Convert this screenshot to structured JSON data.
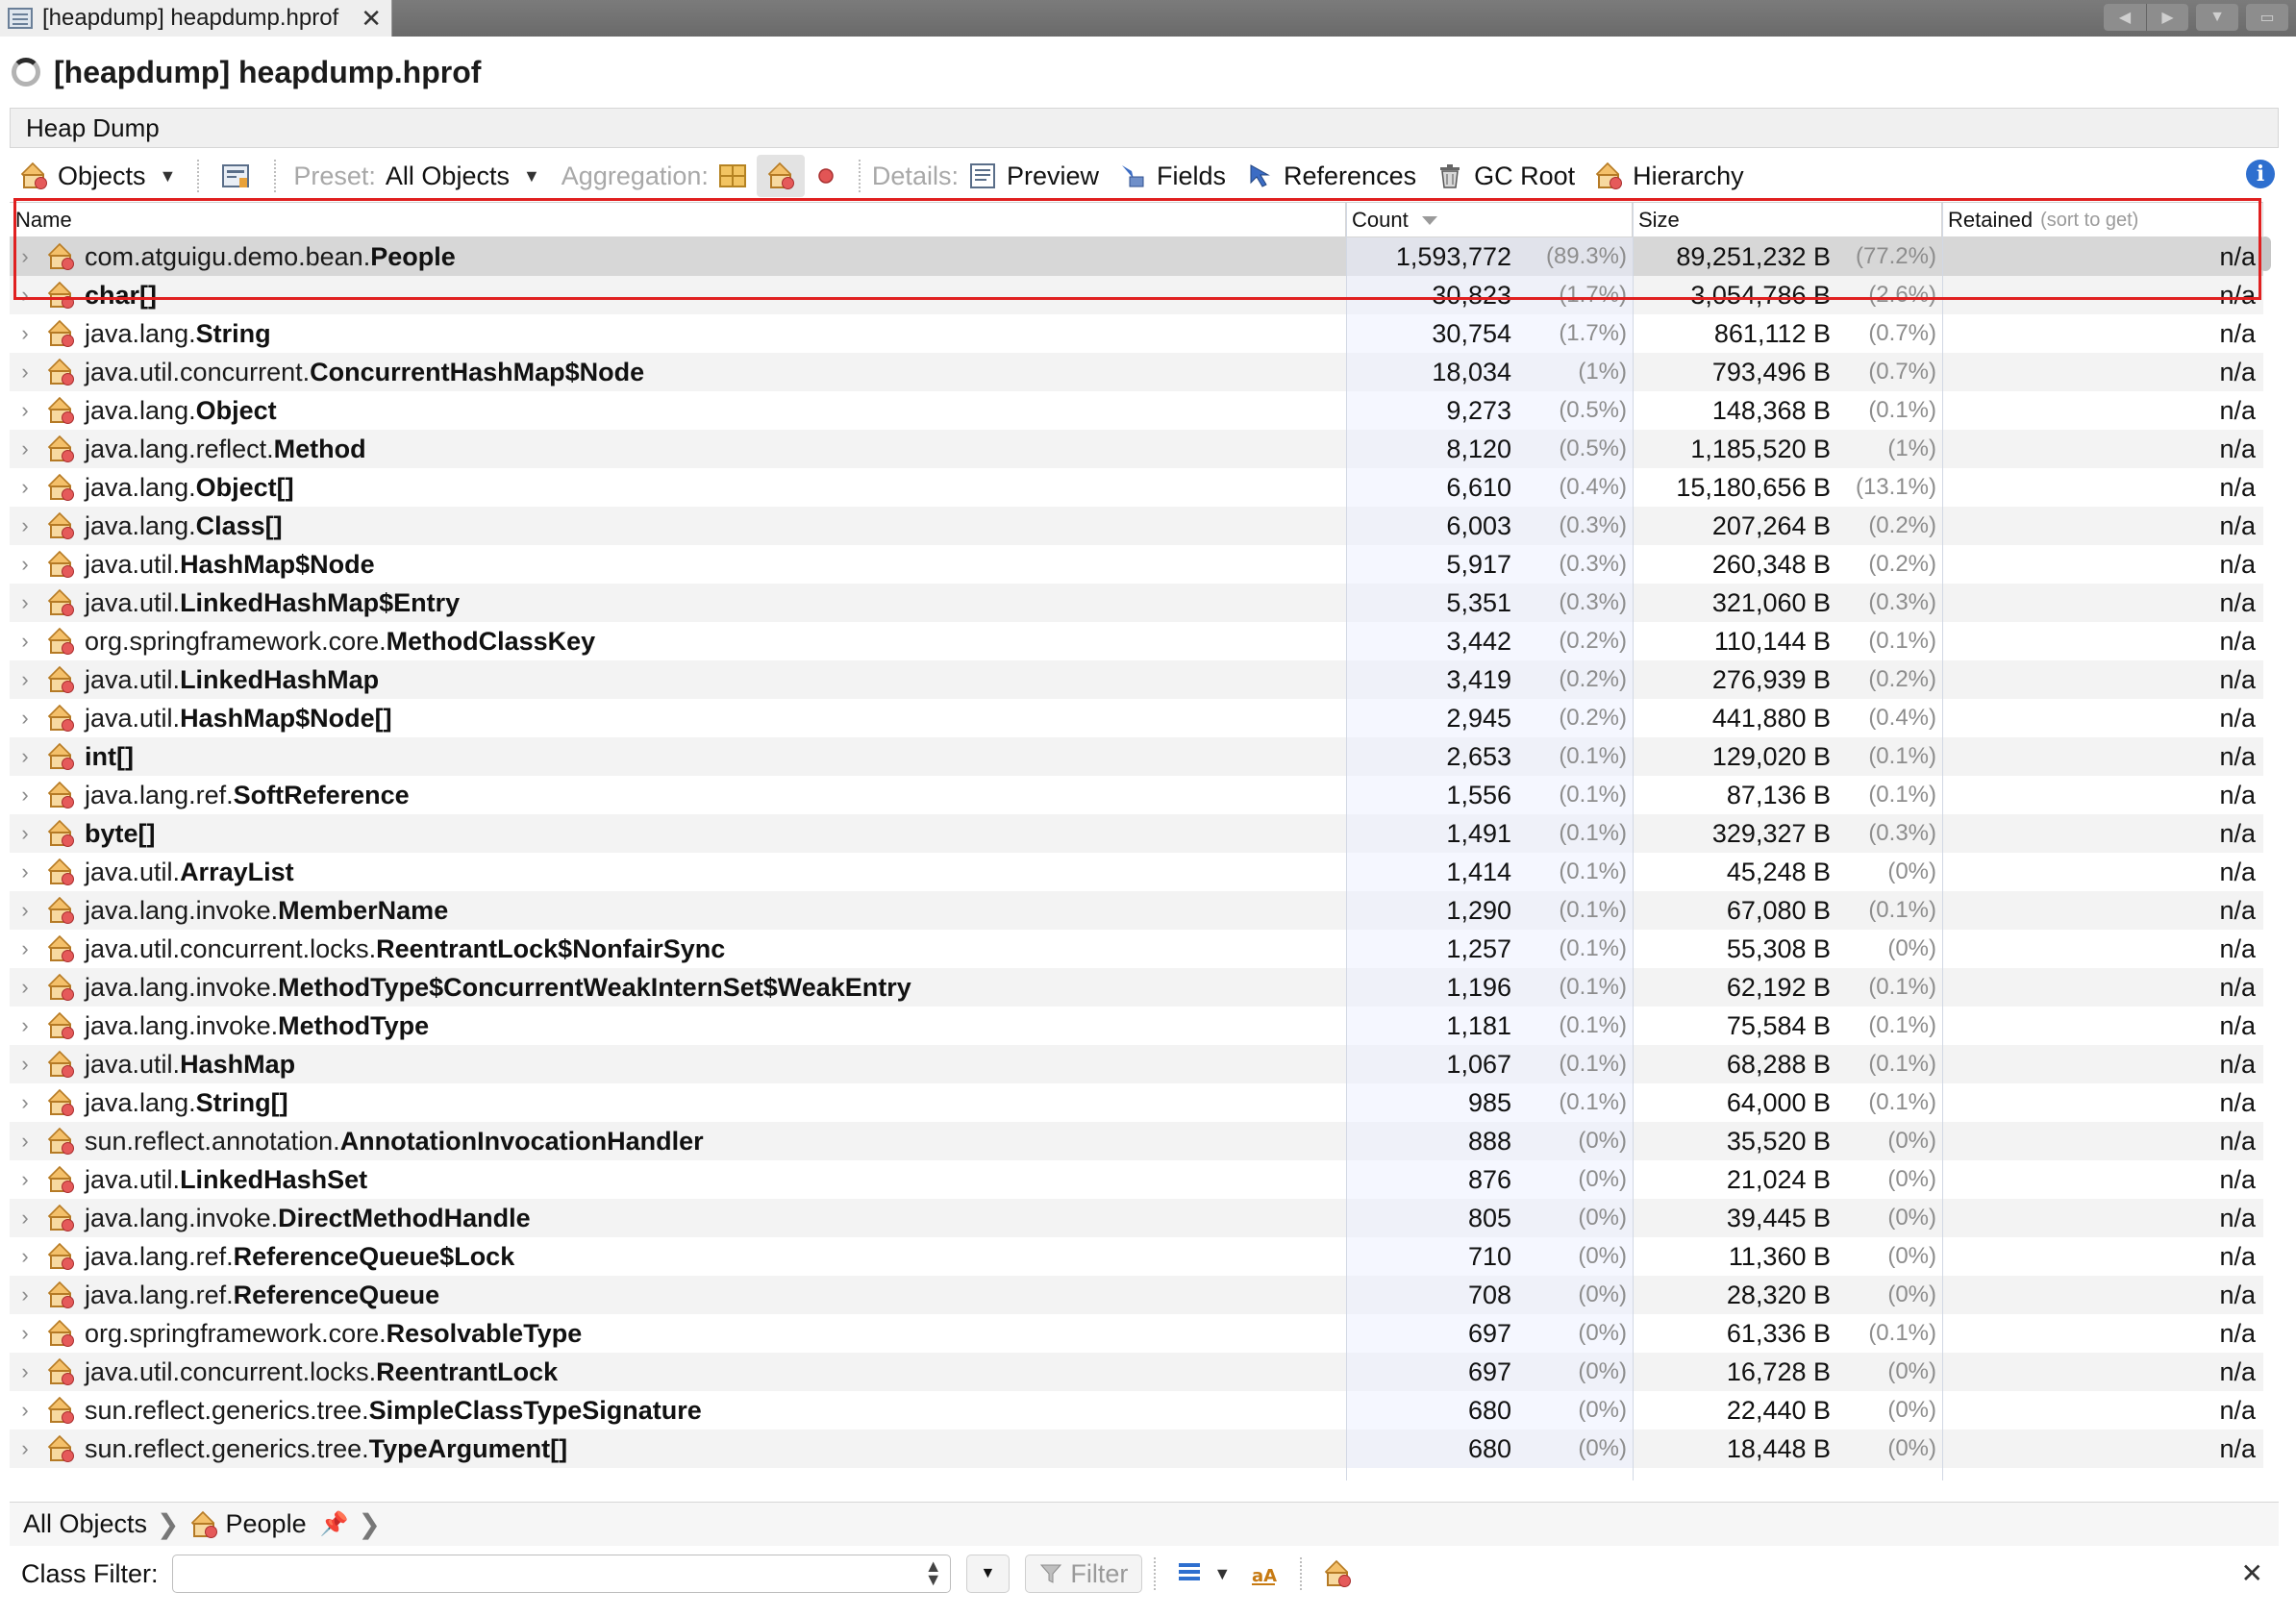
{
  "tab": {
    "label": "[heapdump] heapdump.hprof",
    "close": "✕"
  },
  "title": "[heapdump] heapdump.hprof",
  "section_header": "Heap Dump",
  "toolbar": {
    "objects_label": "Objects",
    "preset_label": "Preset:",
    "preset_value": "All Objects",
    "aggregation_label": "Aggregation:",
    "details_label": "Details:",
    "preview": "Preview",
    "fields": "Fields",
    "references": "References",
    "gc_root": "GC Root",
    "hierarchy": "Hierarchy",
    "info": "i"
  },
  "table": {
    "columns": {
      "name": "Name",
      "count": "Count",
      "size": "Size",
      "retained": "Retained",
      "retained_hint": "(sort to get)"
    },
    "rows": [
      {
        "pkg": "com.atguigu.demo.bean.",
        "cls": "People",
        "count": "1,593,772",
        "count_pct": "(89.3%)",
        "size": "89,251,232 B",
        "size_pct": "(77.2%)",
        "retained": "n/a"
      },
      {
        "pkg": "",
        "cls": "char[]",
        "count": "30,823",
        "count_pct": "(1.7%)",
        "size": "3,054,786 B",
        "size_pct": "(2.6%)",
        "retained": "n/a"
      },
      {
        "pkg": "java.lang.",
        "cls": "String",
        "count": "30,754",
        "count_pct": "(1.7%)",
        "size": "861,112 B",
        "size_pct": "(0.7%)",
        "retained": "n/a"
      },
      {
        "pkg": "java.util.concurrent.",
        "cls": "ConcurrentHashMap$Node",
        "count": "18,034",
        "count_pct": "(1%)",
        "size": "793,496 B",
        "size_pct": "(0.7%)",
        "retained": "n/a"
      },
      {
        "pkg": "java.lang.",
        "cls": "Object",
        "count": "9,273",
        "count_pct": "(0.5%)",
        "size": "148,368 B",
        "size_pct": "(0.1%)",
        "retained": "n/a"
      },
      {
        "pkg": "java.lang.reflect.",
        "cls": "Method",
        "count": "8,120",
        "count_pct": "(0.5%)",
        "size": "1,185,520 B",
        "size_pct": "(1%)",
        "retained": "n/a"
      },
      {
        "pkg": "java.lang.",
        "cls": "Object[]",
        "count": "6,610",
        "count_pct": "(0.4%)",
        "size": "15,180,656 B",
        "size_pct": "(13.1%)",
        "retained": "n/a"
      },
      {
        "pkg": "java.lang.",
        "cls": "Class[]",
        "count": "6,003",
        "count_pct": "(0.3%)",
        "size": "207,264 B",
        "size_pct": "(0.2%)",
        "retained": "n/a"
      },
      {
        "pkg": "java.util.",
        "cls": "HashMap$Node",
        "count": "5,917",
        "count_pct": "(0.3%)",
        "size": "260,348 B",
        "size_pct": "(0.2%)",
        "retained": "n/a"
      },
      {
        "pkg": "java.util.",
        "cls": "LinkedHashMap$Entry",
        "count": "5,351",
        "count_pct": "(0.3%)",
        "size": "321,060 B",
        "size_pct": "(0.3%)",
        "retained": "n/a"
      },
      {
        "pkg": "org.springframework.core.",
        "cls": "MethodClassKey",
        "count": "3,442",
        "count_pct": "(0.2%)",
        "size": "110,144 B",
        "size_pct": "(0.1%)",
        "retained": "n/a"
      },
      {
        "pkg": "java.util.",
        "cls": "LinkedHashMap",
        "count": "3,419",
        "count_pct": "(0.2%)",
        "size": "276,939 B",
        "size_pct": "(0.2%)",
        "retained": "n/a"
      },
      {
        "pkg": "java.util.",
        "cls": "HashMap$Node[]",
        "count": "2,945",
        "count_pct": "(0.2%)",
        "size": "441,880 B",
        "size_pct": "(0.4%)",
        "retained": "n/a"
      },
      {
        "pkg": "",
        "cls": "int[]",
        "count": "2,653",
        "count_pct": "(0.1%)",
        "size": "129,020 B",
        "size_pct": "(0.1%)",
        "retained": "n/a"
      },
      {
        "pkg": "java.lang.ref.",
        "cls": "SoftReference",
        "count": "1,556",
        "count_pct": "(0.1%)",
        "size": "87,136 B",
        "size_pct": "(0.1%)",
        "retained": "n/a"
      },
      {
        "pkg": "",
        "cls": "byte[]",
        "count": "1,491",
        "count_pct": "(0.1%)",
        "size": "329,327 B",
        "size_pct": "(0.3%)",
        "retained": "n/a"
      },
      {
        "pkg": "java.util.",
        "cls": "ArrayList",
        "count": "1,414",
        "count_pct": "(0.1%)",
        "size": "45,248 B",
        "size_pct": "(0%)",
        "retained": "n/a"
      },
      {
        "pkg": "java.lang.invoke.",
        "cls": "MemberName",
        "count": "1,290",
        "count_pct": "(0.1%)",
        "size": "67,080 B",
        "size_pct": "(0.1%)",
        "retained": "n/a"
      },
      {
        "pkg": "java.util.concurrent.locks.",
        "cls": "ReentrantLock$NonfairSync",
        "count": "1,257",
        "count_pct": "(0.1%)",
        "size": "55,308 B",
        "size_pct": "(0%)",
        "retained": "n/a"
      },
      {
        "pkg": "java.lang.invoke.",
        "cls": "MethodType$ConcurrentWeakInternSet$WeakEntry",
        "count": "1,196",
        "count_pct": "(0.1%)",
        "size": "62,192 B",
        "size_pct": "(0.1%)",
        "retained": "n/a"
      },
      {
        "pkg": "java.lang.invoke.",
        "cls": "MethodType",
        "count": "1,181",
        "count_pct": "(0.1%)",
        "size": "75,584 B",
        "size_pct": "(0.1%)",
        "retained": "n/a"
      },
      {
        "pkg": "java.util.",
        "cls": "HashMap",
        "count": "1,067",
        "count_pct": "(0.1%)",
        "size": "68,288 B",
        "size_pct": "(0.1%)",
        "retained": "n/a"
      },
      {
        "pkg": "java.lang.",
        "cls": "String[]",
        "count": "985",
        "count_pct": "(0.1%)",
        "size": "64,000 B",
        "size_pct": "(0.1%)",
        "retained": "n/a"
      },
      {
        "pkg": "sun.reflect.annotation.",
        "cls": "AnnotationInvocationHandler",
        "count": "888",
        "count_pct": "(0%)",
        "size": "35,520 B",
        "size_pct": "(0%)",
        "retained": "n/a"
      },
      {
        "pkg": "java.util.",
        "cls": "LinkedHashSet",
        "count": "876",
        "count_pct": "(0%)",
        "size": "21,024 B",
        "size_pct": "(0%)",
        "retained": "n/a"
      },
      {
        "pkg": "java.lang.invoke.",
        "cls": "DirectMethodHandle",
        "count": "805",
        "count_pct": "(0%)",
        "size": "39,445 B",
        "size_pct": "(0%)",
        "retained": "n/a"
      },
      {
        "pkg": "java.lang.ref.",
        "cls": "ReferenceQueue$Lock",
        "count": "710",
        "count_pct": "(0%)",
        "size": "11,360 B",
        "size_pct": "(0%)",
        "retained": "n/a"
      },
      {
        "pkg": "java.lang.ref.",
        "cls": "ReferenceQueue",
        "count": "708",
        "count_pct": "(0%)",
        "size": "28,320 B",
        "size_pct": "(0%)",
        "retained": "n/a"
      },
      {
        "pkg": "org.springframework.core.",
        "cls": "ResolvableType",
        "count": "697",
        "count_pct": "(0%)",
        "size": "61,336 B",
        "size_pct": "(0.1%)",
        "retained": "n/a"
      },
      {
        "pkg": "java.util.concurrent.locks.",
        "cls": "ReentrantLock",
        "count": "697",
        "count_pct": "(0%)",
        "size": "16,728 B",
        "size_pct": "(0%)",
        "retained": "n/a"
      },
      {
        "pkg": "sun.reflect.generics.tree.",
        "cls": "SimpleClassTypeSignature",
        "count": "680",
        "count_pct": "(0%)",
        "size": "22,440 B",
        "size_pct": "(0%)",
        "retained": "n/a"
      },
      {
        "pkg": "sun.reflect.generics.tree.",
        "cls": "TypeArgument[]",
        "count": "680",
        "count_pct": "(0%)",
        "size": "18,448 B",
        "size_pct": "(0%)",
        "retained": "n/a"
      }
    ]
  },
  "breadcrumb": {
    "root": "All Objects",
    "current": "People"
  },
  "class_filter": {
    "label": "Class Filter:",
    "value": "",
    "filter_button": "Filter",
    "close": "✕"
  },
  "colors": {
    "highlight": "#e02020",
    "selected_row": "#d7d7d7",
    "alt_row": "#f3f3f3"
  },
  "icons": [
    "window-icon",
    "close-icon",
    "spinner-icon",
    "class-icon",
    "snapshot-icon",
    "info-icon",
    "preview-icon",
    "fields-icon",
    "references-icon",
    "gc-root-icon",
    "hierarchy-icon",
    "pin-icon",
    "filter-icon",
    "expand-icon"
  ]
}
